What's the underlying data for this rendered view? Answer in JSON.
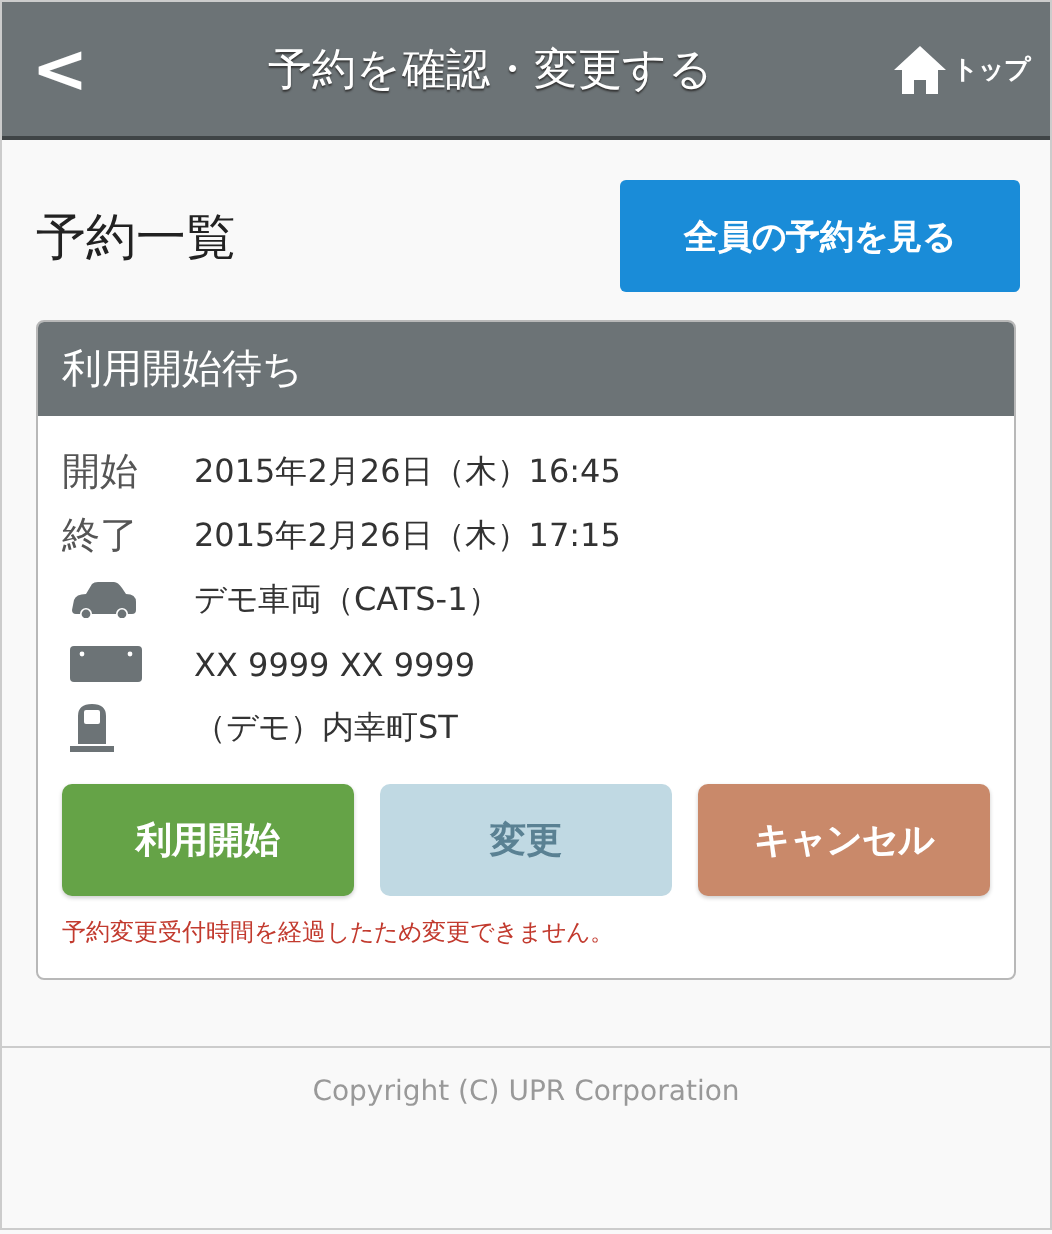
{
  "header": {
    "back_icon": "<",
    "title": "予約を確認・変更する",
    "home_label": "トップ"
  },
  "page_title": "予約一覧",
  "all_reservations_button": "全員の予約を見る",
  "reservation": {
    "status": "利用開始待ち",
    "rows": [
      {
        "kind": "label",
        "label": "開始",
        "value": "2015年2月26日（木）16:45"
      },
      {
        "kind": "label",
        "label": "終了",
        "value": "2015年2月26日（木）17:15"
      },
      {
        "kind": "car",
        "value": "デモ車両（CATS-1）"
      },
      {
        "kind": "plate",
        "value": "XX 9999 XX 9999"
      },
      {
        "kind": "station",
        "value": "（デモ）内幸町ST"
      }
    ],
    "buttons": [
      {
        "kind": "start",
        "label": "利用開始",
        "disabled": false
      },
      {
        "kind": "change",
        "label": "変更",
        "disabled": true
      },
      {
        "kind": "cancel",
        "label": "キャンセル",
        "disabled": false
      }
    ],
    "notice": "予約変更受付時間を経過したため変更できません。"
  },
  "footer": "Copyright (C) UPR Corporation"
}
